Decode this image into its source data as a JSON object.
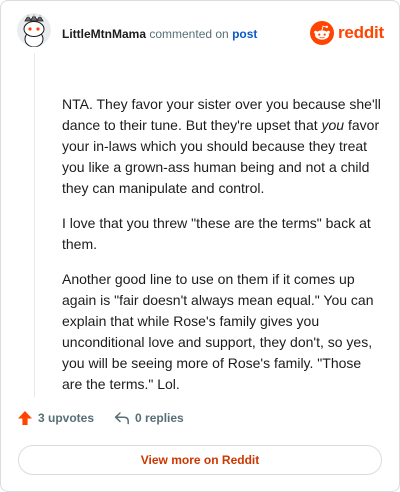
{
  "header": {
    "username": "LittleMtnMama",
    "commented_text": "commented on",
    "post_link": "post",
    "brand_word": "reddit",
    "brand_color": "#ff4500"
  },
  "comment": {
    "p1_before": "NTA. They favor your sister over you because she'll dance to their tune. But they're upset that ",
    "p1_em": "you",
    "p1_after": " favor your in-laws which you should because they treat you like a grown-ass human being and not a child they can manipulate and control.",
    "p2": "I love that you threw \"these are the terms\" back at them.",
    "p3": "Another good line to use on them if it comes up again is \"fair doesn't always mean equal.\" You can explain that while Rose's family gives you unconditional love and support, they don't, so yes, you will be seeing more of Rose's family. \"Those are the terms.\" Lol."
  },
  "actions": {
    "upvotes": "3 upvotes",
    "replies": "0 replies",
    "upvote_icon": "upvote-arrow-icon",
    "reply_icon": "reply-arrow-icon",
    "upvote_color": "#ff4500"
  },
  "footer": {
    "view_more": "View more on Reddit"
  }
}
